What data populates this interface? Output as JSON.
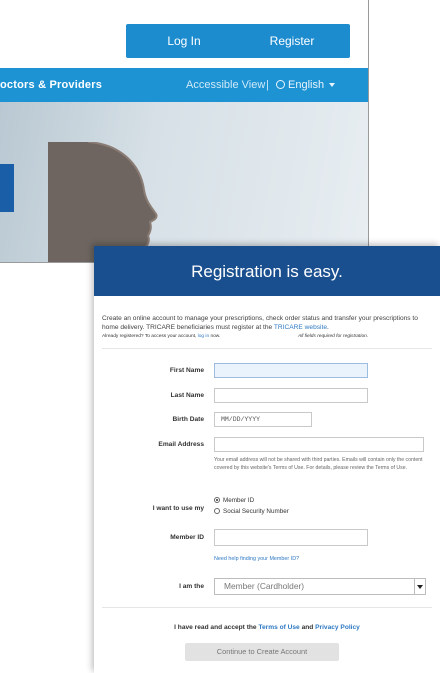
{
  "background_page": {
    "login_label": "Log In",
    "register_label": "Register",
    "nav_doctors": "octors & Providers",
    "nav_accessible": "Accessible View",
    "nav_separator": "|",
    "nav_language": "English"
  },
  "registration": {
    "title": "Registration is easy.",
    "intro_main": "Create an online account to manage your prescriptions, check order status and transfer your prescriptions to home delivery. TRICARE beneficiaries must register at the ",
    "intro_link": "TRICARE website",
    "intro_end": ".",
    "already_text": "Already registered? To access your account, ",
    "login_link": "log in",
    "login_end": " now.",
    "required_note": "All fields required for registration.",
    "fields": {
      "first_name_label": "First Name",
      "last_name_label": "Last Name",
      "birth_date_label": "Birth Date",
      "birth_date_placeholder": "MM/DD/YYYY",
      "email_label": "Email Address",
      "email_help": "Your email address will not be shared with third parties. Emails will contain only the content covered by this website's Terms of Use. For details, please review the Terms of Use.",
      "use_my_label": "I want to use my",
      "option_member_id": "Member ID",
      "option_ssn": "Social Security Number",
      "member_id_label": "Member ID",
      "member_id_help": "Need help finding your Member ID?",
      "i_am_label": "I am the",
      "i_am_value": "Member (Cardholder)"
    },
    "agree_prefix": "I have read and accept the ",
    "terms_link": "Terms of Use",
    "agree_and": " and ",
    "privacy_link": "Privacy Policy",
    "continue_label": "Continue to Create Account"
  },
  "colors": {
    "header_blue": "#1a4f8f",
    "nav_blue": "#1e93d3",
    "button_blue": "#1d8ccf",
    "link_blue": "#2f79c3"
  }
}
